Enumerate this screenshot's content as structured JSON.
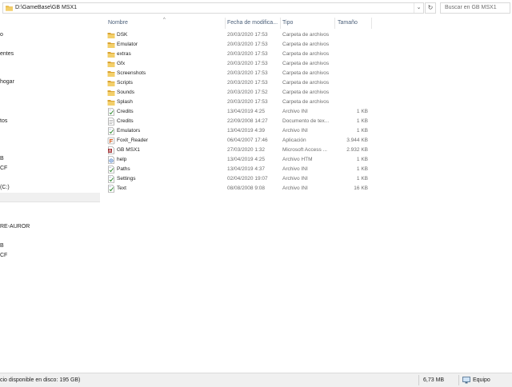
{
  "address": {
    "path": "D:\\GameBase\\GB MSX1",
    "search_placeholder": "Buscar en GB MSX1",
    "dropdown_icon": "chevron-down-icon",
    "refresh_icon": "refresh-icon"
  },
  "nav": {
    "items": [
      {
        "label": "o"
      },
      {
        "label": "entes"
      },
      {
        "label": "hogar"
      },
      {
        "label": "tos"
      },
      {
        "label": "B"
      },
      {
        "label": "CF"
      },
      {
        "label": "(C:)"
      },
      {
        "label": "RE-AUROR"
      },
      {
        "label": "B"
      },
      {
        "label": "CF"
      }
    ]
  },
  "columns": {
    "name": "Nombre",
    "date": "Fecha de modifica...",
    "type": "Tipo",
    "size": "Tamaño"
  },
  "files": [
    {
      "name": "DSK",
      "date": "20/03/2020 17:53",
      "type": "Carpeta de archivos",
      "size": "",
      "icon": "folder-icon"
    },
    {
      "name": "Emulator",
      "date": "20/03/2020 17:53",
      "type": "Carpeta de archivos",
      "size": "",
      "icon": "folder-icon"
    },
    {
      "name": "extras",
      "date": "20/03/2020 17:53",
      "type": "Carpeta de archivos",
      "size": "",
      "icon": "folder-icon"
    },
    {
      "name": "Gfx",
      "date": "20/03/2020 17:53",
      "type": "Carpeta de archivos",
      "size": "",
      "icon": "folder-icon"
    },
    {
      "name": "Screenshots",
      "date": "20/03/2020 17:53",
      "type": "Carpeta de archivos",
      "size": "",
      "icon": "folder-icon"
    },
    {
      "name": "Scripts",
      "date": "20/03/2020 17:53",
      "type": "Carpeta de archivos",
      "size": "",
      "icon": "folder-icon"
    },
    {
      "name": "Sounds",
      "date": "20/03/2020 17:52",
      "type": "Carpeta de archivos",
      "size": "",
      "icon": "folder-icon"
    },
    {
      "name": "Splash",
      "date": "20/03/2020 17:53",
      "type": "Carpeta de archivos",
      "size": "",
      "icon": "folder-icon"
    },
    {
      "name": "Credits",
      "date": "13/04/2019 4:25",
      "type": "Archivo INI",
      "size": "1 KB",
      "icon": "ini-file-icon"
    },
    {
      "name": "Credits",
      "date": "22/09/2008 14:27",
      "type": "Documento de tex...",
      "size": "1 KB",
      "icon": "text-file-icon"
    },
    {
      "name": "Emulators",
      "date": "13/04/2019 4:39",
      "type": "Archivo INI",
      "size": "1 KB",
      "icon": "ini-file-icon"
    },
    {
      "name": "Foxit_Reader",
      "date": "06/04/2007 17:46",
      "type": "Aplicación",
      "size": "3.944 KB",
      "icon": "application-icon"
    },
    {
      "name": "GB MSX1",
      "date": "27/03/2020 1:32",
      "type": "Microsoft Access ...",
      "size": "2.932 KB",
      "icon": "access-database-icon"
    },
    {
      "name": "help",
      "date": "13/04/2019 4:25",
      "type": "Archivo HTM",
      "size": "1 KB",
      "icon": "html-file-icon"
    },
    {
      "name": "Paths",
      "date": "13/04/2019 4:37",
      "type": "Archivo INI",
      "size": "1 KB",
      "icon": "ini-file-icon"
    },
    {
      "name": "Settings",
      "date": "02/04/2020 19:07",
      "type": "Archivo INI",
      "size": "1 KB",
      "icon": "ini-file-icon"
    },
    {
      "name": "Text",
      "date": "08/08/2008 9:08",
      "type": "Archivo INI",
      "size": "16 KB",
      "icon": "ini-file-icon"
    }
  ],
  "status": {
    "free_space": "cio disponible en disco: 195 GB)",
    "size": "6,73 MB",
    "location": "Equipo",
    "location_icon": "computer-icon"
  },
  "colors": {
    "folder": "#e8b948",
    "header_text": "#4c607a",
    "status_bg": "#f0f0f0"
  }
}
